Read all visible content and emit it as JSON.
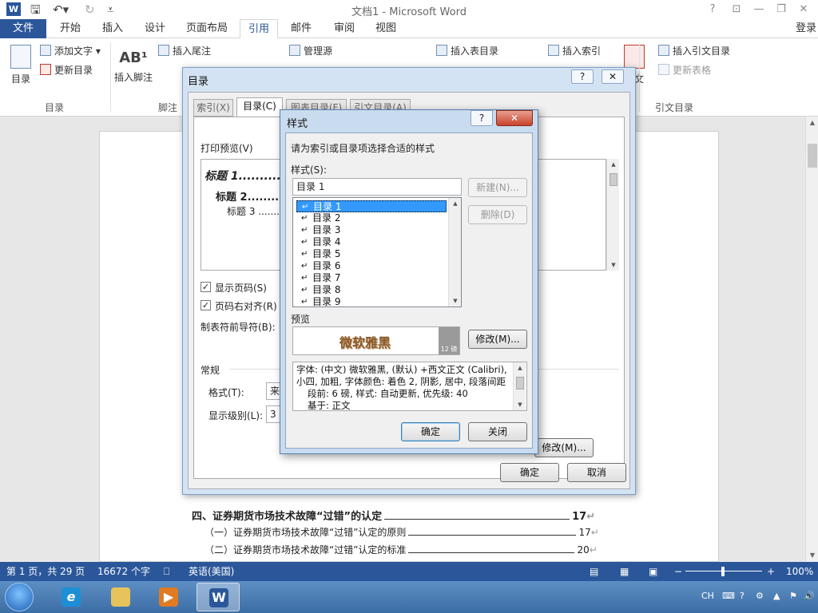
{
  "titlebar": {
    "title": "文档1 - Microsoft Word",
    "app_icon": "W",
    "help": "?",
    "minimize": "—",
    "restore": "❐",
    "close": "✕"
  },
  "tabs": {
    "file": "文件",
    "items": [
      "开始",
      "插入",
      "设计",
      "页面布局",
      "引用",
      "邮件",
      "审阅",
      "视图"
    ],
    "signin": "登录"
  },
  "ribbon": {
    "toc_big": "目录",
    "add_text": "添加文字",
    "update_toc": "更新目录",
    "group_toc": "目录",
    "insert_footnote": "插入脚注",
    "insert_endnote": "插入尾注",
    "group_footnote": "脚注",
    "manage_sources": "管理源",
    "insert_table_of_figures": "插入表目录",
    "insert_index": "插入索引",
    "citation": "引文",
    "insert_toa": "插入引文目录",
    "update_table": "更新表格",
    "group_toa": "引文目录"
  },
  "document": {
    "toc_lines": [
      {
        "text": "四、证券期货市场技术故障“过错”的认定",
        "page": "17"
      },
      {
        "text": "（一）证券期货市场技术故障“过错”认定的原则",
        "page": "17"
      },
      {
        "text": "（二）证券期货市场技术故障“过错”认定的标准",
        "page": "20"
      }
    ]
  },
  "toc_dialog": {
    "title": "目录",
    "help": "?",
    "close": "✕",
    "tabs": [
      "索引(X)",
      "目录(C)",
      "图表目录(F)",
      "引文目录(A)"
    ],
    "print_preview_label": "打印预览(V)",
    "preview_lines": [
      "标题 1..........",
      "标题 2........",
      "标题 3 ......."
    ],
    "show_page_numbers": "显示页码(S)",
    "right_align": "页码右对齐(R)",
    "tab_leader_label": "制表符前导符(B):",
    "general_label": "常规",
    "format_label": "格式(T):",
    "format_value": "来",
    "levels_label": "显示级别(L):",
    "levels_value": "3",
    "modify_button": "修改(M)...",
    "ok": "确定",
    "cancel": "取消"
  },
  "style_dialog": {
    "title": "样式",
    "help": "?",
    "close": "✕",
    "instruction": "请为索引或目录项选择合适的样式",
    "styles_label": "样式(S):",
    "style_input": "目录 1",
    "new_button": "新建(N)...",
    "delete_button": "删除(D)",
    "styles": [
      "目录 1",
      "目录 2",
      "目录 3",
      "目录 4",
      "目录 5",
      "目录 6",
      "目录 7",
      "目录 8",
      "目录 9"
    ],
    "preview_label": "预览",
    "preview_text": "微软雅黑",
    "preview_size": "12 磅",
    "modify_button": "修改(M)...",
    "description": "字体: (中文) 微软雅黑, (默认) +西文正文 (Calibri), 小四, 加粗, 字体颜色: 着色 2, 阴影, 居中, 段落间距",
    "description2": "段前: 6 磅, 样式: 自动更新, 优先级: 40",
    "description3": "基于: 正文",
    "ok": "确定",
    "close_button": "关闭"
  },
  "status": {
    "page": "第 1 页，共 29 页",
    "words": "16672 个字",
    "language": "英语(美国)",
    "zoom": "100%"
  },
  "tray": {
    "lang": "CH"
  }
}
